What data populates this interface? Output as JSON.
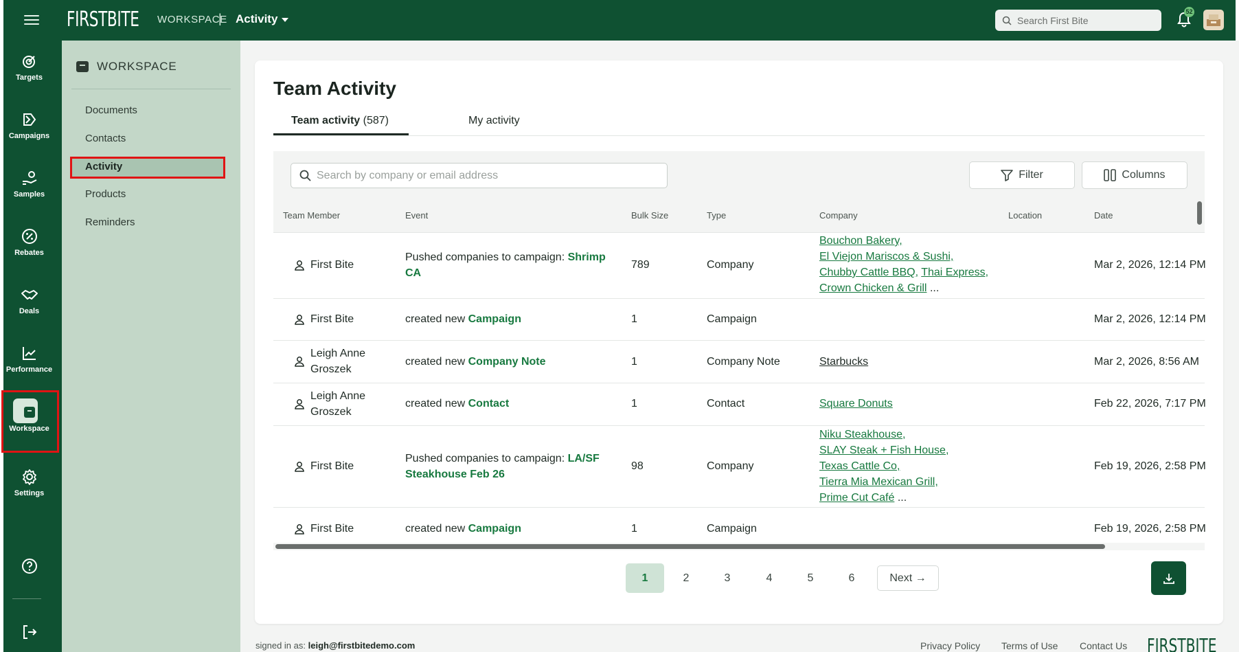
{
  "app": {
    "logo": "FIRSTBITE",
    "section_label": "WORKSPACE",
    "section_sep": "|",
    "current_view": "Activity",
    "search_placeholder": "Search First Bite",
    "notification_count": "52"
  },
  "rail": {
    "items": [
      {
        "label": "Targets",
        "icon": "target-icon"
      },
      {
        "label": "Campaigns",
        "icon": "campaign-flag-icon"
      },
      {
        "label": "Samples",
        "icon": "samples-hand-icon"
      },
      {
        "label": "Rebates",
        "icon": "rebate-percent-icon"
      },
      {
        "label": "Deals",
        "icon": "handshake-icon"
      },
      {
        "label": "Performance",
        "icon": "trend-chart-icon"
      },
      {
        "label": "Workspace",
        "icon": "archive-box-icon"
      },
      {
        "label": "Settings",
        "icon": "gear-icon"
      }
    ],
    "active": "Workspace"
  },
  "subnav": {
    "title": "WORKSPACE",
    "items": [
      "Documents",
      "Contacts",
      "Activity",
      "Products",
      "Reminders"
    ],
    "active": "Activity"
  },
  "page": {
    "title": "Team Activity",
    "tabs": [
      {
        "label": "Team activity",
        "count": "(587)"
      },
      {
        "label": "My activity"
      }
    ],
    "search_placeholder": "Search by company or email address",
    "filter_label": "Filter",
    "columns_label": "Columns"
  },
  "table": {
    "headers": [
      "Team Member",
      "Event",
      "Bulk Size",
      "Type",
      "Company",
      "Location",
      "Date"
    ],
    "rows": [
      {
        "member": "First Bite",
        "event_text": "Pushed companies to campaign:",
        "event_link": "Shrimp CA",
        "bulk": "789",
        "type": "Company",
        "companies": [
          "Bouchon Bakery,",
          "El Viejon Mariscos & Sushi,",
          "Chubby Cattle BBQ,",
          "Thai Express,",
          "Crown Chicken & Grill"
        ],
        "more": "...",
        "location": "",
        "date": "Mar 2, 2026, 12:14 PM"
      },
      {
        "member": "First Bite",
        "event_text": "created new",
        "event_link": "Campaign",
        "bulk": "1",
        "type": "Campaign",
        "companies": [],
        "location": "",
        "date": "Mar 2, 2026, 12:14 PM"
      },
      {
        "member": "Leigh Anne Groszek",
        "event_text": "created new",
        "event_link": "Company Note",
        "bulk": "1",
        "type": "Company Note",
        "companies": [
          "Starbucks"
        ],
        "location": "",
        "date": "Mar 2, 2026, 8:56 AM"
      },
      {
        "member": "Leigh Anne Groszek",
        "event_text": "created new",
        "event_link": "Contact",
        "bulk": "1",
        "type": "Contact",
        "companies": [
          "Square Donuts"
        ],
        "location": "",
        "date": "Feb 22, 2026, 7:17 PM"
      },
      {
        "member": "First Bite",
        "event_text": "Pushed companies to campaign:",
        "event_link": "LA/SF Steakhouse Feb 26",
        "bulk": "98",
        "type": "Company",
        "companies": [
          "Niku Steakhouse,",
          "SLAY Steak + Fish House,",
          "Texas Cattle Co,",
          "Tierra Mia Mexican Grill,",
          "Prime Cut Café"
        ],
        "more": "...",
        "location": "",
        "date": "Feb 19, 2026, 2:58 PM"
      },
      {
        "member": "First Bite",
        "event_text": "created new",
        "event_link": "Campaign",
        "bulk": "1",
        "type": "Campaign",
        "companies": [],
        "location": "",
        "date": "Feb 19, 2026, 2:58 PM"
      }
    ]
  },
  "pagination": {
    "pages": [
      "1",
      "2",
      "3",
      "4",
      "5",
      "6"
    ],
    "current": "1",
    "next_label": "Next →"
  },
  "footer": {
    "signed_in_prefix": "signed in as:",
    "email": "leigh@firstbitedemo.com",
    "links": [
      "Privacy Policy",
      "Terms of Use",
      "Contact Us"
    ],
    "logo": "FIRSTBITE"
  },
  "colors": {
    "brand": "#0f5132",
    "accent_link": "#17793f",
    "subnav_bg": "#c3d7c8",
    "highlight": "#e01414"
  }
}
